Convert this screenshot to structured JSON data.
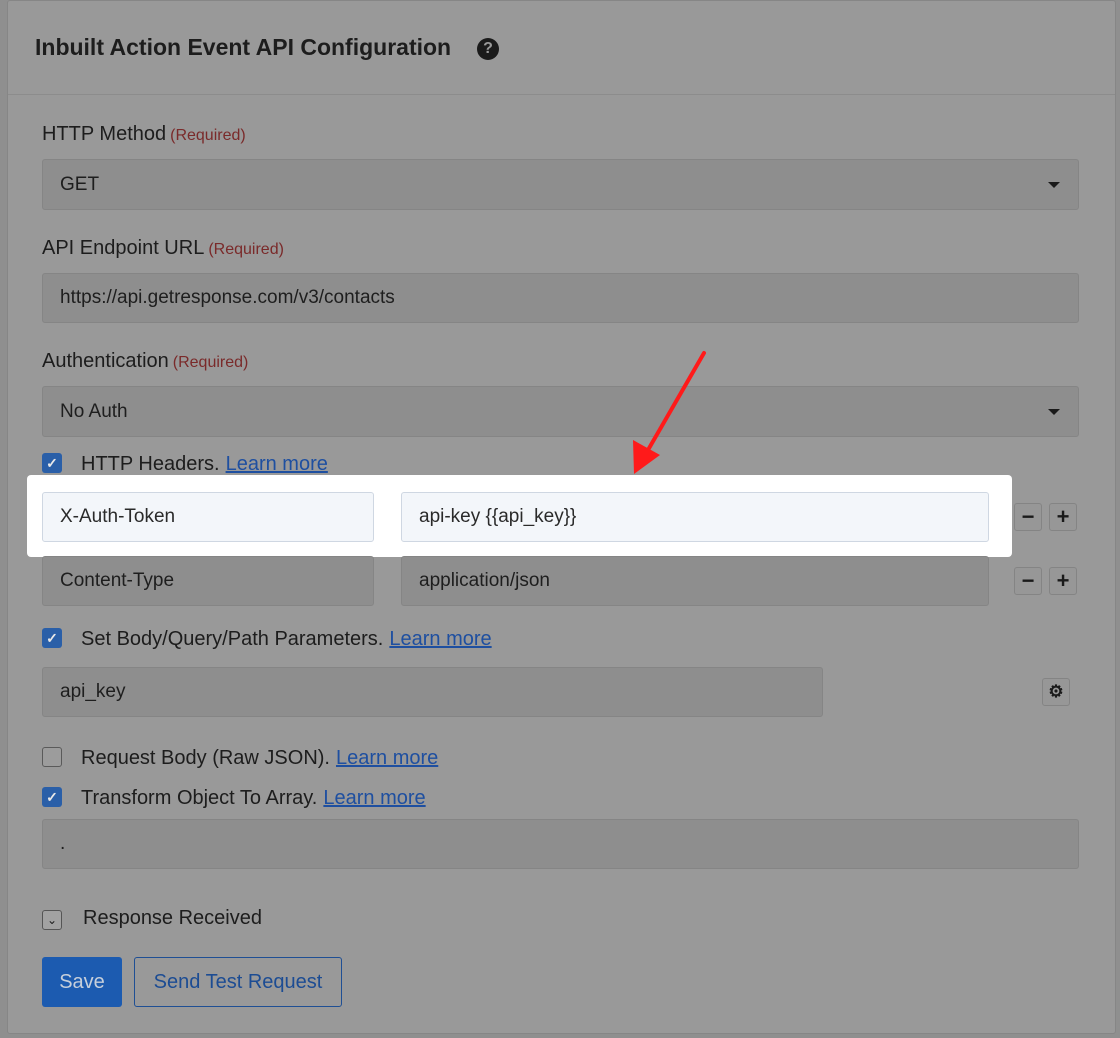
{
  "title": "Inbuilt Action Event API Configuration",
  "help_icon": "question-circle-icon",
  "required_text": "(Required)",
  "http_method": {
    "label": "HTTP Method",
    "value": "GET"
  },
  "endpoint": {
    "label": "API Endpoint URL",
    "value": "https://api.getresponse.com/v3/contacts"
  },
  "authentication": {
    "label": "Authentication",
    "value": "No Auth"
  },
  "headers": {
    "label": "HTTP Headers.",
    "link": "Learn more",
    "checked": true,
    "rows": [
      {
        "key": "X-Auth-Token",
        "value": "api-key {{api_key}}"
      },
      {
        "key": "Content-Type",
        "value": "application/json"
      }
    ]
  },
  "body_params": {
    "label": "Set Body/Query/Path Parameters.",
    "link": "Learn more",
    "checked": true,
    "value": "api_key"
  },
  "raw_json": {
    "label": "Request Body (Raw JSON).",
    "link": "Learn more",
    "checked": false
  },
  "transform": {
    "label": "Transform Object To Array.",
    "link": "Learn more",
    "checked": true,
    "value": "."
  },
  "response": {
    "label": "Response Received"
  },
  "buttons": {
    "save": "Save",
    "test": "Send Test Request"
  },
  "symbols": {
    "check": "✓",
    "minus": "−",
    "plus": "+",
    "gear": "⚙",
    "chevron": "⌄",
    "help": "?"
  },
  "colors": {
    "arrow": "#ff1a1a",
    "primary": "#1c5bb0",
    "highlight": "#ffffff"
  }
}
